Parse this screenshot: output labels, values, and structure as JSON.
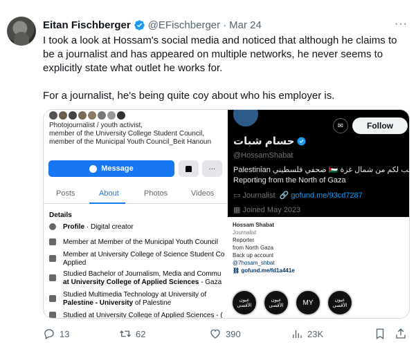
{
  "tweet": {
    "author_name": "Eitan Fischberger",
    "handle": "@EFischberger",
    "separator": "·",
    "date": "Mar 24",
    "more": "···",
    "paragraphs": [
      "I took a look at Hossam's social media and noticed that although he claims to be a journalist and has appeared on multiple networks, he never seems to explicitly state what outlet he works for.",
      "For a journalist, he's being quite coy about who his employer is."
    ],
    "stats": {
      "replies": "13",
      "reposts": "62",
      "likes": "390",
      "views": "23K"
    }
  },
  "facebook": {
    "bio": [
      "Photojournalist / youth activist,",
      "member of the University College Student Council,",
      "member of the Municipal Youth Council_Beit Hanoun"
    ],
    "message_label": "Message",
    "more_label": "···",
    "tabs": [
      "Posts",
      "About",
      "Photos",
      "Videos"
    ],
    "details_heading": "Details",
    "rows": [
      {
        "bold": "Profile",
        "text": " · Digital creator"
      },
      {
        "bold": "",
        "text": "Member at Member of the Municipal Youth Council"
      },
      {
        "bold": "",
        "text": "Member at University College of Science Student Co"
      },
      {
        "bold": "",
        "text": "Applied"
      },
      {
        "bold": "",
        "text": "Studied Bachelor of Journalism, Media and Commu"
      },
      {
        "bold": "at University College of Applied Sciences",
        "text": " - Gaza"
      },
      {
        "bold": "",
        "text": "Studied Multimedia Technology at University of"
      },
      {
        "bold": "Palestine - University",
        "text": " of Palestine"
      },
      {
        "bold": "",
        "text": "Studied at University College of Applied Sciences - ("
      }
    ]
  },
  "x_profile": {
    "follow_label": "Follow",
    "name": "حسام شبات",
    "handle": "@HossamShabat",
    "bio_line1": "Palestinian صحفي فلسطيني 🇵🇸 أكتب لكم من شمال غزة",
    "bio_line2": "Reporting from the North of Gaza",
    "meta_label": "Journalist",
    "meta_link": "gofund.me/93cd7287",
    "joined": "Joined May 2023"
  },
  "instagram": {
    "name": "Hossam Shabat",
    "category": "Journalist",
    "lines": [
      "Reporter",
      "from North Gaza",
      "Back up account"
    ],
    "mention": "@7hosam_shbat",
    "link": "gofund.me/fd1a441e",
    "highlights": [
      "عيون الأقصى",
      "عيون الأقصى",
      "MY",
      "عيون الأقصى"
    ]
  },
  "colors": {
    "accent": "#1d9bf0",
    "facebook_blue": "#1877f2",
    "text_secondary": "#536471"
  }
}
